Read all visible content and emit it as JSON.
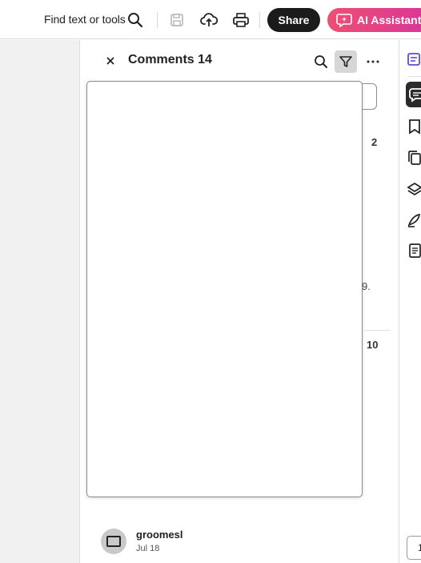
{
  "toolbar": {
    "find_label": "Find text or tools",
    "share_label": "Share",
    "ai_label": "AI Assistant",
    "ai_gradient": [
      "#f04e74",
      "#d8359a"
    ]
  },
  "panel": {
    "title": "Comments 14",
    "counts": [
      "2",
      "10"
    ],
    "fragment": "9."
  },
  "comment": {
    "author": "groomesl",
    "date": "Jul 18"
  },
  "rail": {
    "page_number": "1",
    "icons": [
      "all-tools-icon",
      "comment-icon",
      "bookmark-icon",
      "copy-pages-icon",
      "layers-icon",
      "signature-icon",
      "document-icon"
    ]
  }
}
